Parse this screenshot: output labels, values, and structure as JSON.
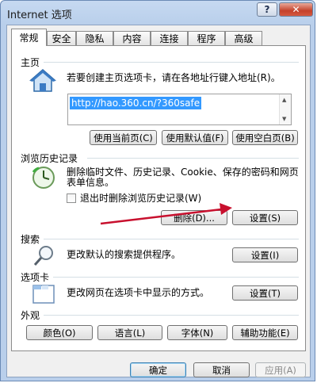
{
  "window": {
    "title": "Internet 选项",
    "help": "?",
    "close": "✕"
  },
  "tabs": [
    "常规",
    "安全",
    "隐私",
    "内容",
    "连接",
    "程序",
    "高级"
  ],
  "home": {
    "section": "主页",
    "desc": "若要创建主页选项卡，请在各地址行键入地址(R)。",
    "url": "http://hao.360.cn/?360safe",
    "btn_current": "使用当前页(C)",
    "btn_default": "使用默认值(F)",
    "btn_blank": "使用空白页(B)"
  },
  "history": {
    "section": "浏览历史记录",
    "desc_line1": "删除临时文件、历史记录、Cookie、保存的密码和网页",
    "desc_line2": "表单信息。",
    "checkbox": "退出时删除浏览历史记录(W)",
    "btn_delete": "删除(D)...",
    "btn_settings": "设置(S)"
  },
  "search": {
    "section": "搜索",
    "desc": "更改默认的搜索提供程序。",
    "btn_settings": "设置(I)"
  },
  "tabsec": {
    "section": "选项卡",
    "desc": "更改网页在选项卡中显示的方式。",
    "btn_settings": "设置(T)"
  },
  "appearance": {
    "section": "外观",
    "btn_colors": "颜色(O)",
    "btn_languages": "语言(L)",
    "btn_fonts": "字体(N)",
    "btn_accessibility": "辅助功能(E)"
  },
  "footer": {
    "ok": "确定",
    "cancel": "取消",
    "apply": "应用(A)"
  },
  "colors": {
    "accent": "#3399ff",
    "arrow": "#c8102e"
  }
}
